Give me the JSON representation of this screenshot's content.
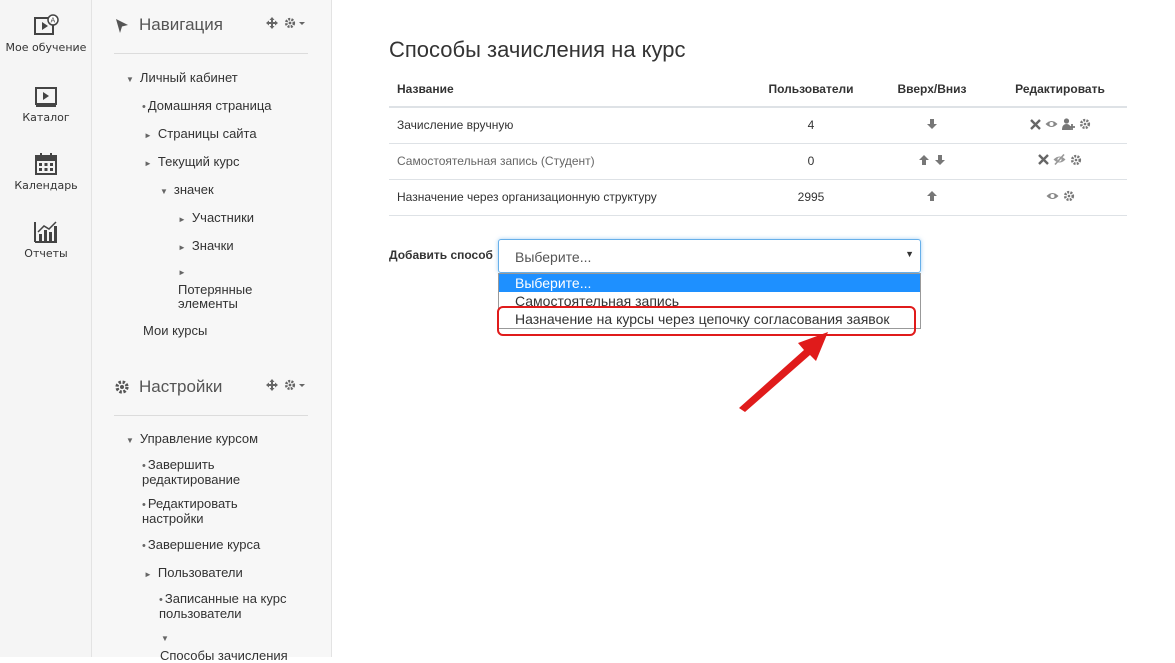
{
  "iconbar": {
    "items": [
      {
        "label": "Мое обучение",
        "icon": "my-courses-icon"
      },
      {
        "label": "Каталог",
        "icon": "catalog-icon"
      },
      {
        "label": "Календарь",
        "icon": "calendar-icon"
      },
      {
        "label": "Отчеты",
        "icon": "reports-icon"
      }
    ]
  },
  "navigation": {
    "title": "Навигация",
    "items": [
      "Личный кабинет",
      "Домашняя страница",
      "Страницы сайта",
      "Текущий курс",
      "значек",
      "Участники",
      "Значки",
      "Потерянные элементы",
      "Мои курсы"
    ]
  },
  "settings": {
    "title": "Настройки",
    "items": [
      "Управление курсом",
      "Завершить редактирование",
      "Редактировать настройки",
      "Завершение курса",
      "Пользователи",
      "Записанные на курс пользователи",
      "Способы зачисления"
    ]
  },
  "main": {
    "title": "Способы зачисления на курс",
    "columns": [
      "Название",
      "Пользователи",
      "Вверх/Вниз",
      "Редактировать"
    ],
    "rows": [
      {
        "name": "Зачисление вручную",
        "users": "4",
        "updown": [
          "down"
        ],
        "edit": [
          "delete",
          "hide",
          "enrol-users",
          "settings"
        ]
      },
      {
        "name": "Самостоятельная запись (Студент)",
        "users": "0",
        "updown": [
          "up",
          "down"
        ],
        "edit": [
          "delete",
          "show",
          "settings"
        ]
      },
      {
        "name": "Назначение через организационную структуру",
        "users": "2995",
        "updown": [
          "up"
        ],
        "edit": [
          "hide",
          "settings"
        ]
      }
    ],
    "add_label": "Добавить способ",
    "select_value": "Выберите...",
    "options": [
      "Выберите...",
      "Самостоятельная запись",
      "Назначение на курсы через цепочку согласования заявок"
    ]
  },
  "colors": {
    "highlight": "#e01b1b",
    "selected_option": "#1e90ff"
  }
}
